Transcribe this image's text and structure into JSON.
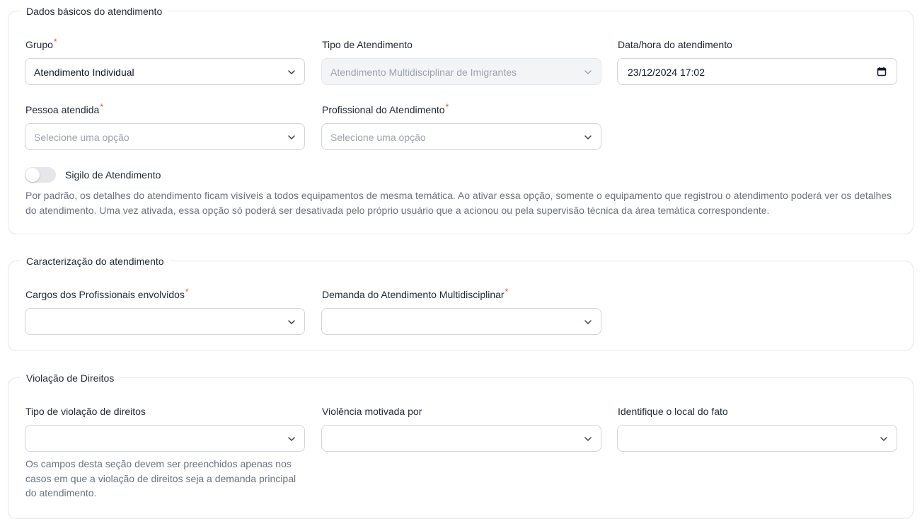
{
  "section_basic": {
    "title": "Dados básicos do atendimento",
    "grupo": {
      "label": "Grupo",
      "required": "*",
      "value": "Atendimento Individual"
    },
    "tipo": {
      "label": "Tipo de Atendimento",
      "value": "Atendimento Multidisciplinar de Imigrantes",
      "disabled": true
    },
    "datahora": {
      "label": "Data/hora do atendimento",
      "value": "23/12/2024 17:02"
    },
    "pessoa": {
      "label": "Pessoa atendida",
      "required": "*",
      "placeholder": "Selecione uma opção"
    },
    "profissional": {
      "label": "Profissional do Atendimento",
      "required": "*",
      "placeholder": "Selecione uma opção"
    },
    "sigilo": {
      "label": "Sigilo de Atendimento",
      "enabled": false,
      "help": "Por padrão, os detalhes do atendimento ficam visíveis a todos equipamentos de mesma temática. Ao ativar essa opção, somente o equipamento que registrou o atendimento poderá ver os detalhes do atendimento. Uma vez ativada, essa opção só poderá ser desativada pelo próprio usuário que a acionou ou pela supervisão técnica da área temática correspondente."
    }
  },
  "section_caracterizacao": {
    "title": "Caracterização do atendimento",
    "cargos": {
      "label": "Cargos dos Profissionais envolvidos",
      "required": "*",
      "value": ""
    },
    "demanda": {
      "label": "Demanda do Atendimento Multidisciplinar",
      "required": "*",
      "value": ""
    }
  },
  "section_violacao": {
    "title": "Violação de Direitos",
    "tipo_violacao": {
      "label": "Tipo de violação de direitos",
      "value": ""
    },
    "violencia": {
      "label": "Violência motivada por",
      "value": ""
    },
    "local": {
      "label": "Identifique o local do fato",
      "value": ""
    },
    "help": "Os campos desta seção devem ser preenchidos apenas nos casos em que a violação de direitos seja a demanda principal do atendimento."
  },
  "icons": {
    "chevron": "chevron-down-icon",
    "calendar": "calendar-icon"
  },
  "colors": {
    "required": "#ef4444",
    "border": "#d1d5db",
    "disabled_bg": "#f3f4f6",
    "helper_text": "#6b7280"
  }
}
